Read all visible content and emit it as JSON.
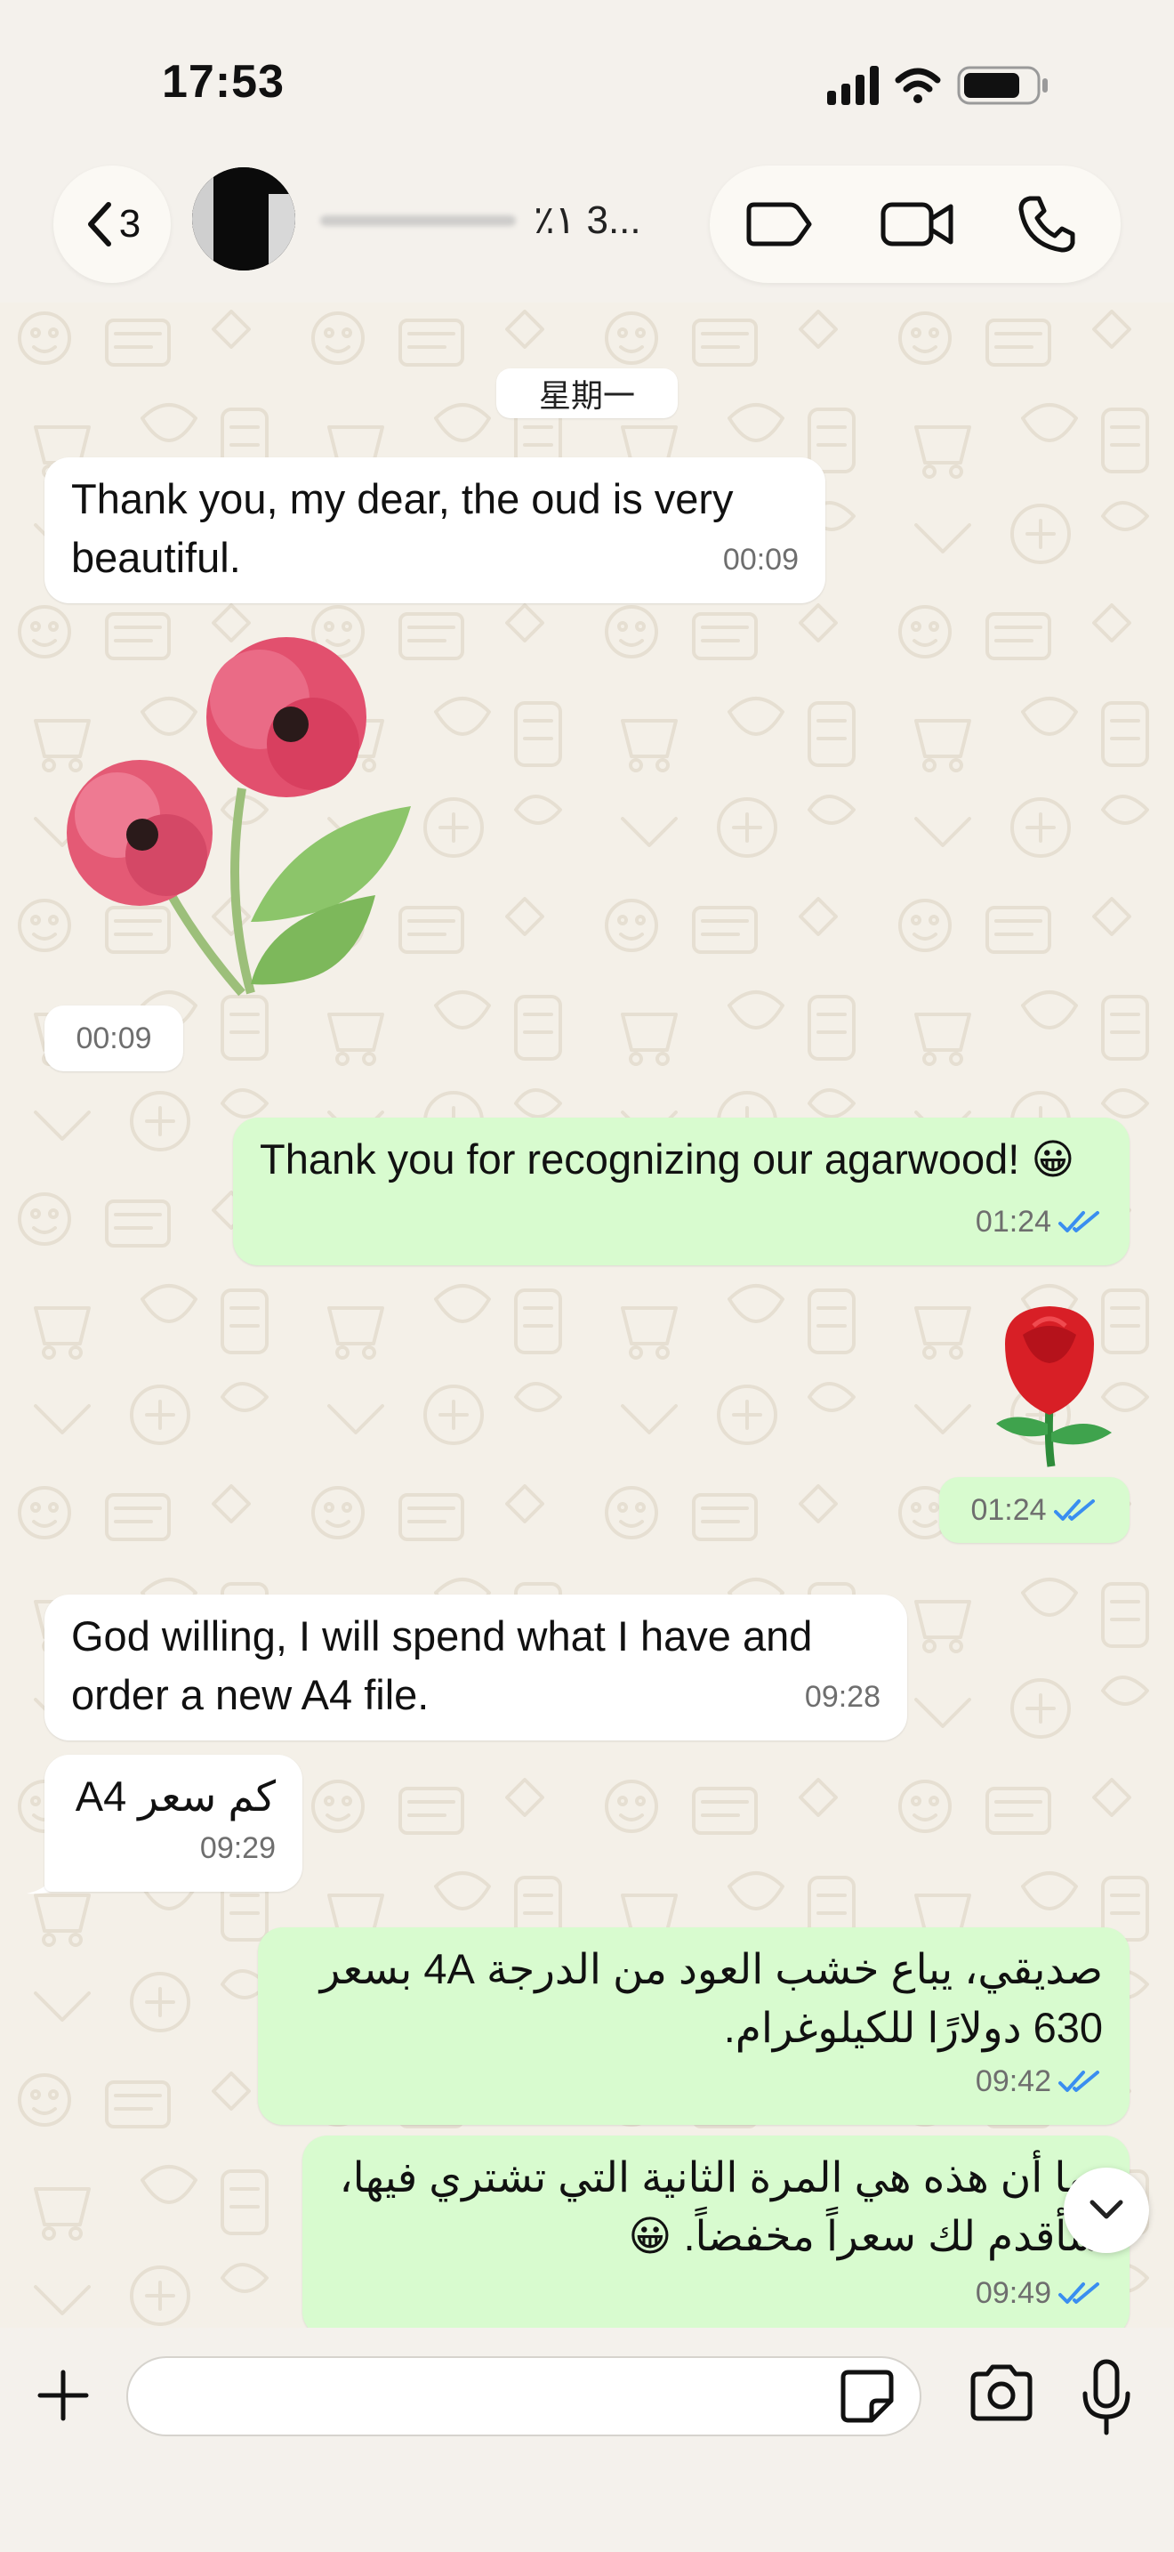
{
  "status_bar": {
    "time": "17:53"
  },
  "header": {
    "back_count": "3",
    "contact_name_visible_tail": "٪۱ 3..."
  },
  "icons": {
    "back": "chevron-left-icon",
    "label": "label-tag-icon",
    "video": "video-camera-icon",
    "phone": "phone-icon",
    "plus": "plus-icon",
    "sticker": "sticker-icon",
    "camera": "camera-icon",
    "mic": "microphone-icon",
    "scroll": "chevron-down-icon"
  },
  "chat": {
    "date_divider": "星期一",
    "messages": [
      {
        "direction": "in",
        "text": "Thank you, my dear, the oud is very beautiful.",
        "time": "00:09"
      },
      {
        "direction": "in",
        "type": "sticker",
        "sticker": "watercolor-poppy-flowers",
        "time": "00:09"
      },
      {
        "direction": "out",
        "text": "Thank you for recognizing our agarwood! 😀",
        "time": "01:24",
        "status": "read"
      },
      {
        "direction": "out",
        "type": "emoji",
        "emoji": "🌹",
        "time": "01:24",
        "status": "read"
      },
      {
        "direction": "in",
        "text": "God willing, I will spend what I have and order a new A4 file.",
        "time": "09:28"
      },
      {
        "direction": "in",
        "text": "كم سعر A4",
        "time": "09:29"
      },
      {
        "direction": "out",
        "text": "صديقي، يباع خشب العود من الدرجة 4A بسعر 630 دولارًا للكيلوغرام.",
        "time": "09:42",
        "status": "read"
      },
      {
        "direction": "out",
        "text": "بما أن هذه هي المرة الثانية التي تشتري فيها، سأقدم لك سعراً مخفضاً. 😀",
        "time": "09:49",
        "status": "read"
      }
    ]
  },
  "colors": {
    "incoming_bubble": "#ffffff",
    "outgoing_bubble": "#d8fbcf",
    "read_ticks": "#3a8ef0",
    "wallpaper": "#f4f0e8"
  },
  "composer": {
    "placeholder": "",
    "value": ""
  }
}
